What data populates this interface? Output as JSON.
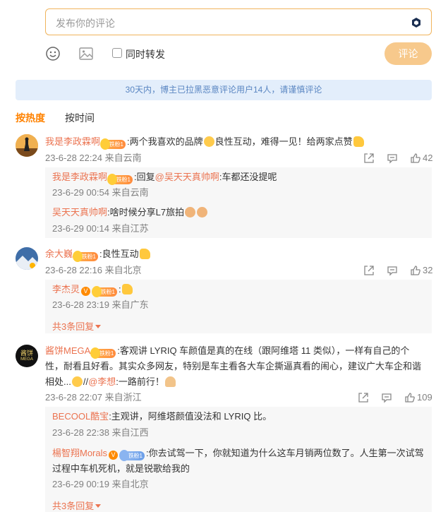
{
  "compose": {
    "placeholder": "发布你的评论",
    "repost_label": "同时转发",
    "submit_label": "评论"
  },
  "notice": "30天内，博主已拉黑恶意评论用户14人，请谨慎评论",
  "sort": {
    "hot": "按热度",
    "time": "按时间"
  },
  "badge_text": "铁粉1",
  "comments": [
    {
      "user": "我是李政霖啊",
      "text": ":两个我喜欢的品牌",
      "text_after": "良性互动，难得一见！给两家点赞",
      "meta": "23-6-28 22:24 来自云南",
      "likes": "42",
      "replies": [
        {
          "user": "我是李政霖啊",
          "pre": ":回复",
          "mention": "@吴天天真帅啊",
          "text": ":车都还没提呢",
          "meta": "23-6-29 00:54 来自云南"
        },
        {
          "user": "吴天天真帅啊",
          "pre": "",
          "mention": "",
          "text": ":啥时候分享L7旅拍",
          "meta": "23-6-29 00:14 来自江苏"
        }
      ]
    },
    {
      "user": "余大巍",
      "text": ":良性互动",
      "meta": "23-6-28 22:16 来自北京",
      "likes": "32",
      "replies": [
        {
          "user": "李杰灵",
          "text": ":",
          "meta": "23-6-28 23:19 来自广东"
        }
      ],
      "more": "共3条回复"
    },
    {
      "user": "酱饼MEGA",
      "text_line1": ":客观讲 LYRIQ 车颜值是真的在线（跟阿维塔 11 类似），一样有自己的个",
      "text_line2": "性，耐看且好看。其实众多网友，特别是车主看各大车企撕逼真看的闹心，建议广大车企和谐",
      "text_line3_a": "相处...",
      "text_line3_b": "//",
      "mention": "@李想",
      "text_line3_c": ":一路前行！",
      "meta": "23-6-28 22:07 来自浙江",
      "likes": "109",
      "avatar_text_1": "酱饼",
      "avatar_text_2": "MEGA",
      "replies": [
        {
          "user": "BECOOL酷宝",
          "text": ":主观讲，阿维塔颜值没法和 LYRIQ 比。",
          "meta": "23-6-28 22:38 来自江西"
        },
        {
          "user": "楊智翔Morals",
          "text_line1": ":你去试驾一下，你就知道为什么这车月销两位数了。人生第一次试驾",
          "text_line2": "过程中车机死机，就是锐歌给我的",
          "meta": "23-6-29 00:19 来自北京"
        }
      ],
      "more": "共3条回复"
    }
  ]
}
